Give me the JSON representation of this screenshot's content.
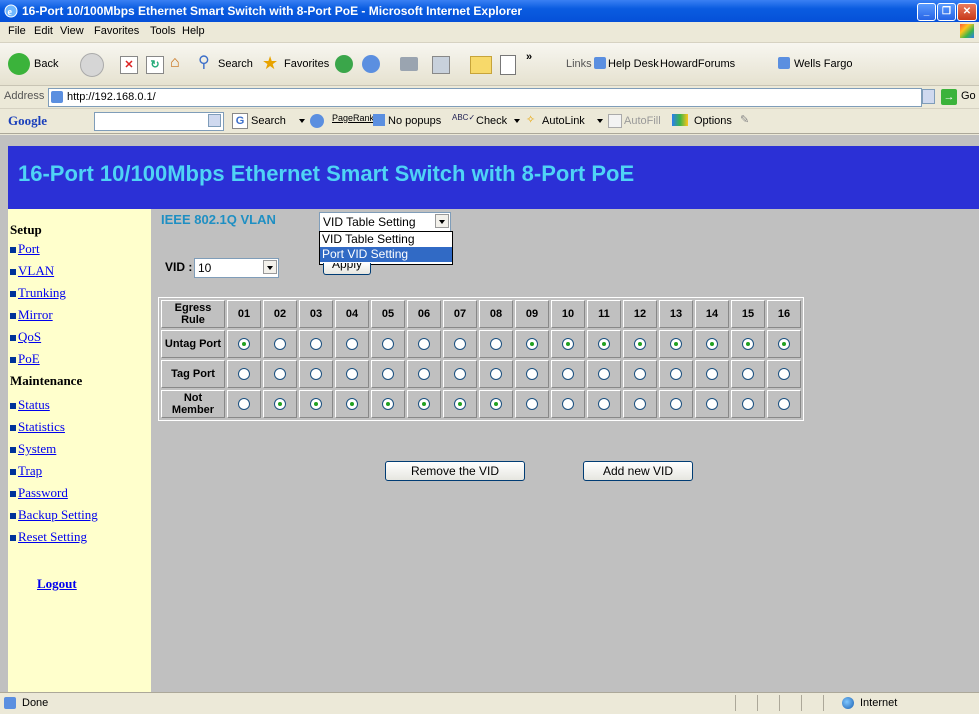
{
  "window": {
    "title": "16-Port 10/100Mbps Ethernet Smart Switch with 8-Port PoE - Microsoft Internet Explorer"
  },
  "menu": [
    "File",
    "Edit",
    "View",
    "Favorites",
    "Tools",
    "Help"
  ],
  "toolbar": {
    "back": "Back",
    "search": "Search",
    "favorites": "Favorites",
    "links_label": "Links",
    "links": [
      "Help Desk",
      "HowardForums",
      "Wells Fargo"
    ]
  },
  "address": {
    "label": "Address",
    "url": "http://192.168.0.1/",
    "go": "Go"
  },
  "google_bar": {
    "logo": "Google",
    "search": "Search",
    "pagerank": "PageRank",
    "popups": "No popups",
    "check": "Check",
    "autolink": "AutoLink",
    "autofill": "AutoFill",
    "options": "Options"
  },
  "page": {
    "banner": "16-Port 10/100Mbps Ethernet Smart Switch with 8-Port PoE",
    "sidebar": {
      "setup_heading": "Setup",
      "setup_items": [
        "Port",
        "VLAN",
        "Trunking",
        "Mirror",
        "QoS",
        "PoE"
      ],
      "maintenance_heading": "Maintenance",
      "maintenance_items": [
        "Status",
        "Statistics",
        "System",
        "Trap",
        "Password",
        "Backup Setting",
        "Reset Setting"
      ],
      "logout": "Logout"
    },
    "vlan": {
      "label": "IEEE 802.1Q VLAN",
      "mode_select": "VID Table Setting",
      "mode_options": [
        "VID Table Setting",
        "Port VID Setting"
      ],
      "highlighted_option": "Port VID Setting",
      "vid_label": "VID :",
      "vid_value": "10",
      "apply": "Apply"
    },
    "egress": {
      "header": "Egress Rule",
      "ports": [
        "01",
        "02",
        "03",
        "04",
        "05",
        "06",
        "07",
        "08",
        "09",
        "10",
        "11",
        "12",
        "13",
        "14",
        "15",
        "16"
      ],
      "rows": [
        {
          "label": "Untag Port",
          "selected": [
            true,
            false,
            false,
            false,
            false,
            false,
            false,
            false,
            true,
            true,
            true,
            true,
            true,
            true,
            true,
            true
          ]
        },
        {
          "label": "Tag Port",
          "selected": [
            false,
            false,
            false,
            false,
            false,
            false,
            false,
            false,
            false,
            false,
            false,
            false,
            false,
            false,
            false,
            false
          ]
        },
        {
          "label": "Not Member",
          "selected": [
            false,
            true,
            true,
            true,
            true,
            true,
            true,
            true,
            false,
            false,
            false,
            false,
            false,
            false,
            false,
            false
          ]
        }
      ]
    },
    "buttons": {
      "remove": "Remove the VID",
      "add": "Add new VID"
    }
  },
  "status": {
    "left": "Done",
    "zone": "Internet"
  }
}
